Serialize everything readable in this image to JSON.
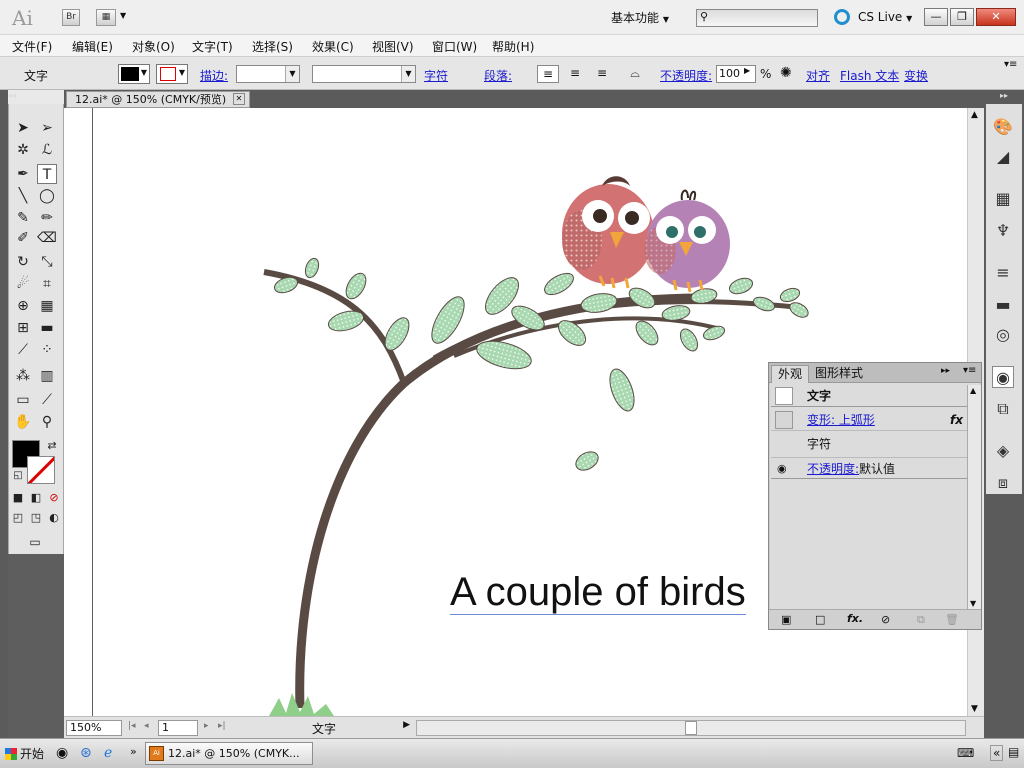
{
  "app": {
    "logo": "Ai",
    "bridge_label": "Br"
  },
  "header": {
    "workspace": "基本功能",
    "search_placeholder": "",
    "cs_live": "CS Live",
    "window_buttons": {
      "minimize": "—",
      "restore": "❐",
      "close": "✕"
    }
  },
  "menu": [
    "文件(F)",
    "编辑(E)",
    "对象(O)",
    "文字(T)",
    "选择(S)",
    "效果(C)",
    "视图(V)",
    "窗口(W)",
    "帮助(H)"
  ],
  "control": {
    "type_label": "文字",
    "stroke_label": "描边:",
    "char_label": "字符",
    "para_label": "段落:",
    "opacity_label": "不透明度:",
    "opacity_value": "100",
    "percent": "%",
    "align_label": "对齐",
    "flash_label": "Flash 文本",
    "transform_label": "变换"
  },
  "document": {
    "tab_title": "12.ai* @ 150% (CMYK/预览)",
    "canvas_text": "A couple of birds"
  },
  "status": {
    "zoom": "150%",
    "page": "1",
    "tool": "文字"
  },
  "appearance": {
    "tab_active": "外观",
    "tab_other": "图形样式",
    "rows": [
      {
        "label": "文字"
      },
      {
        "label": "变形: 上弧形",
        "fx": "fx"
      },
      {
        "label": "字符"
      },
      {
        "label": "不透明度:",
        "value": "默认值"
      }
    ]
  },
  "taskbar": {
    "start": "开始",
    "item": "12.ai* @ 150% (CMYK..."
  },
  "colors": {
    "leaf": "#a8d8b0",
    "branch": "#5a4a44",
    "bird1": "#d27272",
    "bird2": "#b582b6",
    "grass": "#8fcf8a"
  }
}
